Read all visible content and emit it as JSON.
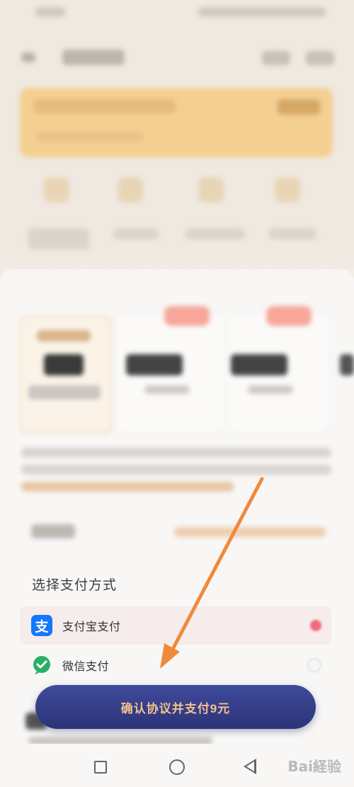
{
  "payment": {
    "section_title": "选择支付方式",
    "options": [
      {
        "label": "支付宝支付",
        "icon": "alipay-icon",
        "selected": true
      },
      {
        "label": "微信支付",
        "icon": "wechat-icon",
        "selected": false
      }
    ]
  },
  "confirm_button": {
    "label": "确认协议并支付9元"
  },
  "watermark": {
    "text": "Bai経验"
  },
  "colors": {
    "accent_orange": "#f08a3a",
    "button_bg": "#2f3a85",
    "button_text": "#f4c18f",
    "alipay_blue": "#1677ff",
    "wechat_green": "#2aae67"
  }
}
